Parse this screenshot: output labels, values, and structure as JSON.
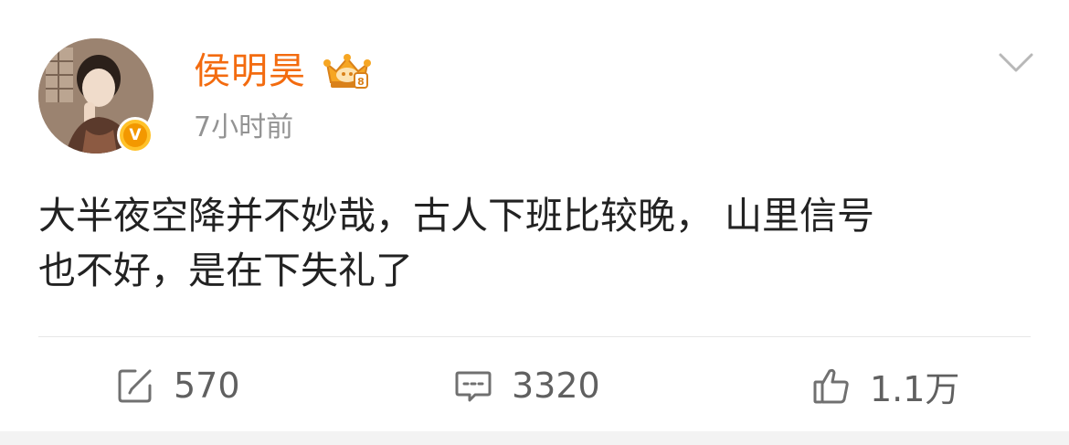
{
  "post": {
    "author": {
      "name": "侯明昊",
      "verified_badge": "V",
      "name_color": "#f36b0f"
    },
    "timestamp": "7小时前",
    "text_line1": "大半夜空降并不妙哉，古人下班比较晚， 山里信号",
    "text_line2": "也不好，是在下失礼了",
    "icons": {
      "member": "crown-member-icon",
      "menu": "chevron-down-icon"
    }
  },
  "actions": {
    "repost": {
      "icon": "share-icon",
      "count": "570"
    },
    "comment": {
      "icon": "comment-icon",
      "count": "3320"
    },
    "like": {
      "icon": "thumbs-up-icon",
      "count": "1.1万"
    }
  },
  "colors": {
    "accent": "#f36b0f",
    "text": "#222222",
    "secondary": "#939393",
    "verified": "#f39800"
  }
}
